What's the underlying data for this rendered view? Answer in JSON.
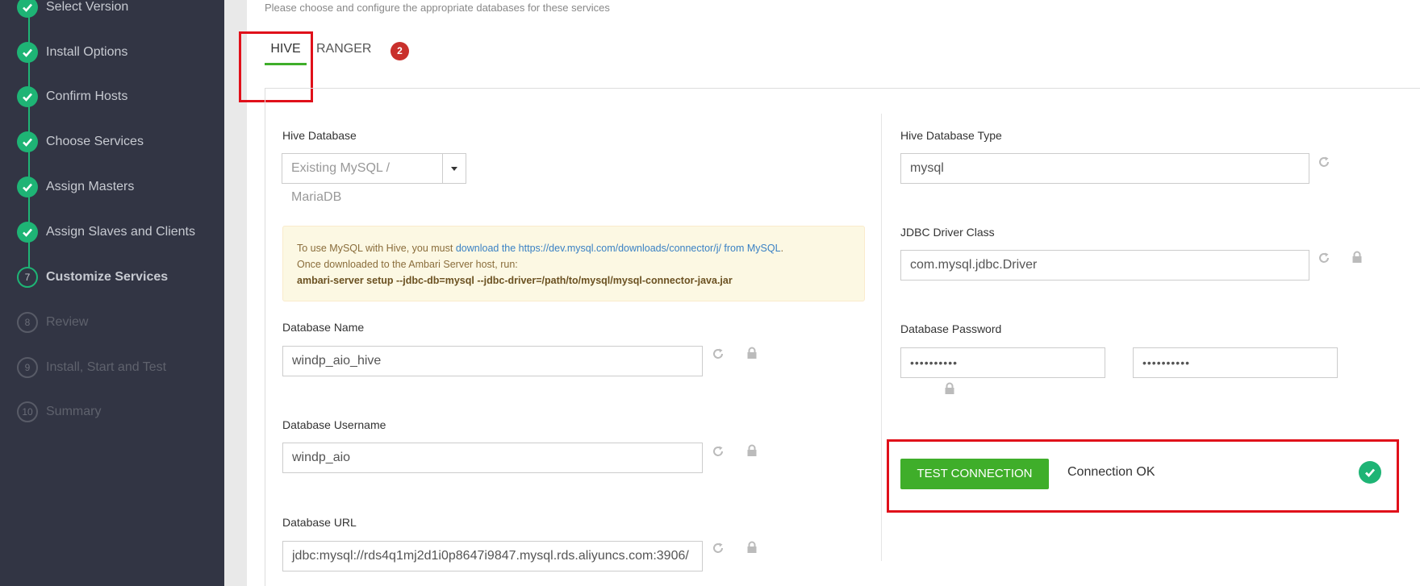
{
  "sidebar": {
    "steps": [
      {
        "num": "1",
        "label": "Select Version",
        "state": "done"
      },
      {
        "num": "2",
        "label": "Install Options",
        "state": "done"
      },
      {
        "num": "3",
        "label": "Confirm Hosts",
        "state": "done"
      },
      {
        "num": "4",
        "label": "Choose Services",
        "state": "done"
      },
      {
        "num": "5",
        "label": "Assign Masters",
        "state": "done"
      },
      {
        "num": "6",
        "label": "Assign Slaves and Clients",
        "state": "done"
      },
      {
        "num": "7",
        "label": "Customize Services",
        "state": "active"
      },
      {
        "num": "8",
        "label": "Review",
        "state": "todo"
      },
      {
        "num": "9",
        "label": "Install, Start and Test",
        "state": "todo"
      },
      {
        "num": "10",
        "label": "Summary",
        "state": "todo"
      }
    ]
  },
  "main": {
    "subtitle": "Please choose and configure the appropriate databases for these services",
    "tabs": [
      {
        "label": "HIVE",
        "active": true
      },
      {
        "label": "RANGER",
        "badge": "2"
      }
    ]
  },
  "left": {
    "hive_database": {
      "label": "Hive Database",
      "value": "Existing MySQL / MariaDB"
    },
    "alert": {
      "pre": "To use MySQL with Hive, you must ",
      "link1": "download the https://dev.mysql.com/downloads/connector/j/ from MySQL",
      "post": ".",
      "line2": "Once downloaded to the Ambari Server host, run:",
      "cmd": "ambari-server setup --jdbc-db=mysql --jdbc-driver=/path/to/mysql/mysql-connector-java.jar"
    },
    "db_name": {
      "label": "Database Name",
      "value": "windp_aio_hive"
    },
    "db_username": {
      "label": "Database Username",
      "value": "windp_aio"
    },
    "db_url": {
      "label": "Database URL",
      "value": "jdbc:mysql://rds4q1mj2d1i0p8647i9847.mysql.rds.aliyuncs.com:3906/"
    }
  },
  "right": {
    "db_type": {
      "label": "Hive Database Type",
      "value": "mysql"
    },
    "jdbc_class": {
      "label": "JDBC Driver Class",
      "value": "com.mysql.jdbc.Driver"
    },
    "db_password": {
      "label": "Database Password",
      "value": "••••••••••",
      "confirm": "••••••••••"
    },
    "test_button": "TEST CONNECTION",
    "status": "Connection OK"
  },
  "colors": {
    "sidebar_bg": "#323544",
    "success": "#1eb475",
    "button": "#3fae2a",
    "badge": "#c9302c",
    "highlight": "#e0101a"
  }
}
